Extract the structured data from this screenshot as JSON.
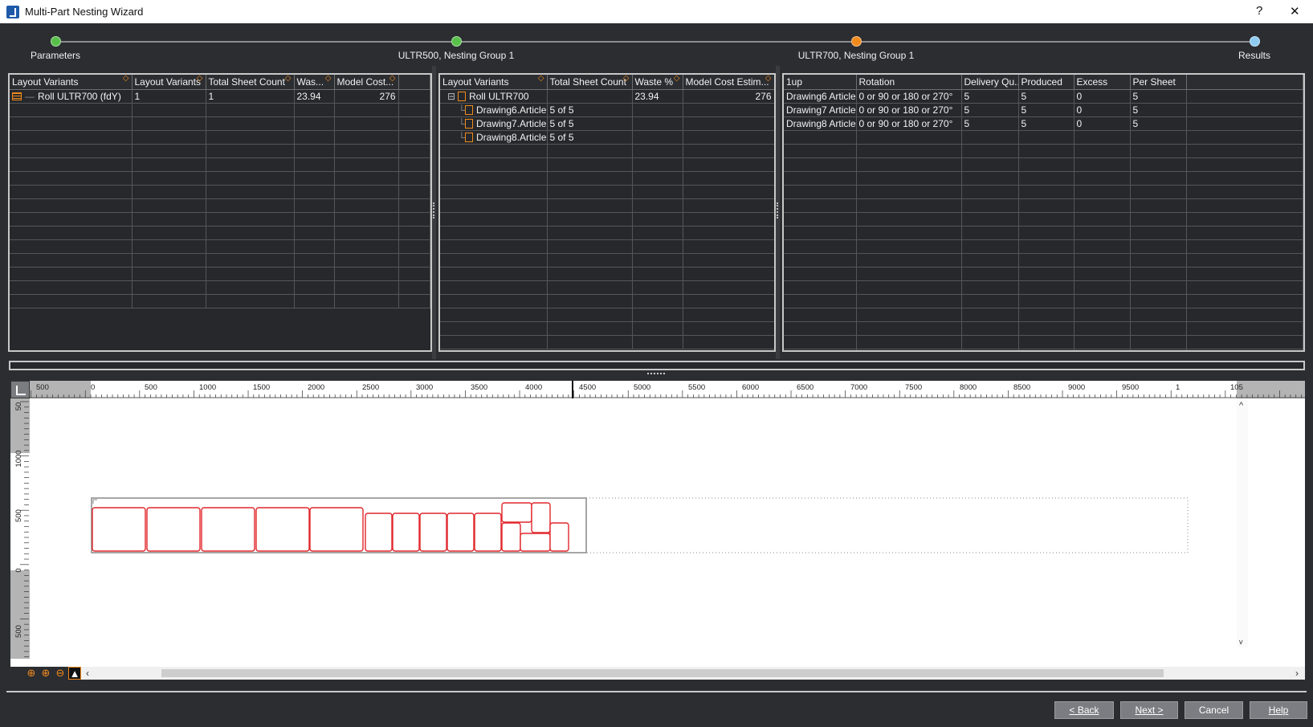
{
  "window": {
    "title": "Multi-Part Nesting Wizard",
    "help_glyph": "?",
    "close_glyph": "✕"
  },
  "steps": [
    {
      "label": "Parameters",
      "state": "done",
      "color": "#59c14b"
    },
    {
      "label": "ULTR500, Nesting Group 1",
      "state": "done",
      "color": "#59c14b"
    },
    {
      "label": "ULTR700, Nesting Group 1",
      "state": "current",
      "color": "#f08a1d"
    },
    {
      "label": "Results",
      "state": "pending",
      "color": "#8ecbf0"
    }
  ],
  "grid1": {
    "headers": [
      "Layout Variants",
      "Layout Variants",
      "Total Sheet Count",
      "Was...",
      "Model Cost..."
    ],
    "rows": [
      {
        "name": "Roll ULTR700 (fdY)",
        "variants": "1",
        "sheet_count": "1",
        "waste": "23.94",
        "cost": "276"
      }
    ]
  },
  "grid2": {
    "headers": [
      "Layout Variants",
      "Total Sheet Count",
      "Waste %",
      "Model Cost Estim..."
    ],
    "parent": {
      "name": "Roll ULTR700",
      "waste": "23.94",
      "cost": "276",
      "expander": "⊟"
    },
    "children": [
      {
        "name": "Drawing6.Article",
        "count": "5 of 5"
      },
      {
        "name": "Drawing7.Article",
        "count": "5 of 5"
      },
      {
        "name": "Drawing8.Article",
        "count": "5 of 5"
      }
    ]
  },
  "grid3": {
    "headers": [
      "1up",
      "Rotation",
      "Delivery Qu...",
      "Produced",
      "Excess",
      "Per Sheet"
    ],
    "rows": [
      {
        "name": "Drawing6 Article",
        "rotation": "0 or 90 or 180 or 270°",
        "delivery": "5",
        "produced": "5",
        "excess": "0",
        "per_sheet": "5"
      },
      {
        "name": "Drawing7 Article",
        "rotation": "0 or 90 or 180 or 270°",
        "delivery": "5",
        "produced": "5",
        "excess": "0",
        "per_sheet": "5"
      },
      {
        "name": "Drawing8 Article",
        "rotation": "0 or 90 or 180 or 270°",
        "delivery": "5",
        "produced": "5",
        "excess": "0",
        "per_sheet": "5"
      }
    ]
  },
  "ruler_top_labels": [
    "500",
    "0",
    "500",
    "1000",
    "1500",
    "2000",
    "2500",
    "3000",
    "3500",
    "4000",
    "4500",
    "5000",
    "5500",
    "6000",
    "6500",
    "7000",
    "7500",
    "8000",
    "8500",
    "9000",
    "9500",
    "1",
    "105"
  ],
  "ruler_left_labels": [
    "50",
    "1000",
    "500",
    "0",
    "500"
  ],
  "zoom_tools": [
    "zoom-fit-icon",
    "zoom-in-icon",
    "zoom-out-icon",
    "image-icon"
  ],
  "buttons": {
    "back": "< Back",
    "next": "Next >",
    "cancel": "Cancel",
    "help": "Help"
  },
  "colors": {
    "accent": "#f08a1d",
    "part_outline": "#e0262b",
    "done": "#59c14b",
    "current": "#f08a1d",
    "pending": "#8ecbf0"
  }
}
